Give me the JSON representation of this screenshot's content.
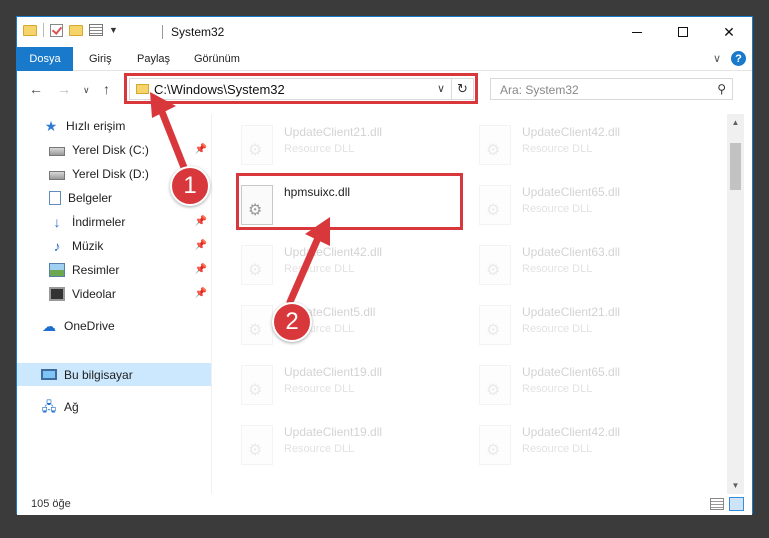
{
  "window": {
    "title": "System32"
  },
  "window_controls": {
    "minimize": "",
    "maximize": "",
    "close": "✕"
  },
  "ribbon": {
    "tabs": [
      "Dosya",
      "Giriş",
      "Paylaş",
      "Görünüm"
    ],
    "active_tab": "Dosya",
    "collapse_icon": "chevron-up-icon",
    "help_label": "?"
  },
  "navigation": {
    "address": "C:\\Windows\\System32",
    "search_placeholder": "Ara: System32"
  },
  "sidebar": {
    "items": [
      {
        "label": "Hızlı erişim",
        "icon": "star-icon",
        "pinned": false
      },
      {
        "label": "Yerel Disk (C:)",
        "icon": "drive-icon",
        "pinned": true
      },
      {
        "label": "Yerel Disk (D:)",
        "icon": "drive-icon",
        "pinned": false
      },
      {
        "label": "Belgeler",
        "icon": "documents-icon",
        "pinned": false
      },
      {
        "label": "İndirmeler",
        "icon": "download-icon",
        "pinned": true
      },
      {
        "label": "Müzik",
        "icon": "music-icon",
        "pinned": true
      },
      {
        "label": "Resimler",
        "icon": "pictures-icon",
        "pinned": true
      },
      {
        "label": "Videolar",
        "icon": "videos-icon",
        "pinned": true
      },
      {
        "label": "OneDrive",
        "icon": "onedrive-icon",
        "pinned": false
      },
      {
        "label": "Bu bilgisayar",
        "icon": "computer-icon",
        "pinned": false,
        "selected": true
      },
      {
        "label": "Ağ",
        "icon": "network-icon",
        "pinned": false
      }
    ]
  },
  "files": {
    "highlighted": {
      "name": "hpmsuixc.dll",
      "type": ""
    },
    "left_column": [
      {
        "name": "UpdateClient21.dll",
        "type": "Resource DLL"
      },
      {
        "name": "UpdateClient42.dll",
        "type": "Resource DLL"
      },
      {
        "name": "UpdateClient5.dll",
        "type": "Resource DLL"
      },
      {
        "name": "UpdateClient19.dll",
        "type": "Resource DLL"
      },
      {
        "name": "UpdateClient19.dll",
        "type": "Resource DLL"
      }
    ],
    "right_column": [
      {
        "name": "UpdateClient42.dll",
        "type": "Resource DLL"
      },
      {
        "name": "UpdateClient65.dll",
        "type": "Resource DLL"
      },
      {
        "name": "UpdateClient63.dll",
        "type": "Resource DLL"
      },
      {
        "name": "UpdateClient21.dll",
        "type": "Resource DLL"
      },
      {
        "name": "UpdateClient65.dll",
        "type": "Resource DLL"
      },
      {
        "name": "UpdateClient42.dll",
        "type": "Resource DLL"
      }
    ]
  },
  "status": {
    "item_count": "105 öğe"
  },
  "callouts": {
    "step1": "1",
    "step2": "2",
    "color": "#d8383c"
  },
  "colors": {
    "accent": "#1979ca",
    "selection": "#cce8ff"
  }
}
